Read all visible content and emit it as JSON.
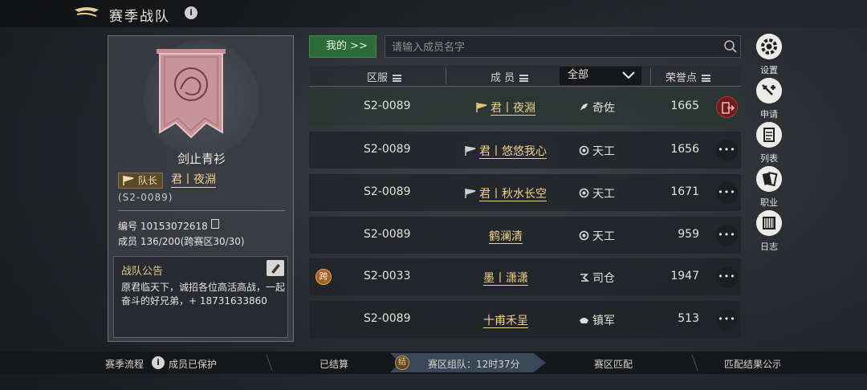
{
  "header": {
    "title": "赛季战队",
    "info": "i"
  },
  "team": {
    "name": "剑止青衫",
    "leader_badge": "队长",
    "leader_name": "君丨夜淵",
    "leader_server": "(S2-0089)",
    "id_label": "编号 10153072618",
    "members_label": "成员 136/200(跨赛区30/30)",
    "notice_title": "战队公告",
    "notice_text": "原君临天下，诚招各位高活高战，一起奋斗的好兄弟，+ 18731633860"
  },
  "toolbar": {
    "mine_label": "我的 >>",
    "search_placeholder": "请输入成员名字"
  },
  "table": {
    "headers": {
      "server": "区服",
      "member": "成 员",
      "filter": "全部",
      "honor": "荣誉点"
    },
    "rows": [
      {
        "server": "S2-0089",
        "name": "君丨夜淵",
        "job": "奇佐",
        "honor": "1665",
        "flag": "leader",
        "action": "leave",
        "cross": ""
      },
      {
        "server": "S2-0089",
        "name": "君丨悠悠我心",
        "job": "天工",
        "honor": "1656",
        "flag": "officer",
        "action": "more",
        "cross": ""
      },
      {
        "server": "S2-0089",
        "name": "君丨秋水长空",
        "job": "天工",
        "honor": "1671",
        "flag": "officer",
        "action": "more",
        "cross": ""
      },
      {
        "server": "S2-0089",
        "name": "鹤澜清",
        "job": "天工",
        "honor": "959",
        "flag": "",
        "action": "more",
        "cross": ""
      },
      {
        "server": "S2-0033",
        "name": "墨丨潇潇",
        "job": "司仓",
        "honor": "1947",
        "flag": "",
        "action": "more",
        "cross": "跨"
      },
      {
        "server": "S2-0089",
        "name": "十甫禾呈",
        "job": "镇军",
        "honor": "513",
        "flag": "",
        "action": "more",
        "cross": ""
      }
    ]
  },
  "side": [
    {
      "label": "设置",
      "icon": "gear-icon"
    },
    {
      "label": "申请",
      "icon": "apply-icon"
    },
    {
      "label": "列表",
      "icon": "list-icon"
    },
    {
      "label": "职业",
      "icon": "profession-icon"
    },
    {
      "label": "日志",
      "icon": "log-icon"
    }
  ],
  "bottom": {
    "season_flow": "赛季流程",
    "protected": "成员已保护",
    "settled": "已结算",
    "active_badge": "结",
    "active_stage": "赛区组队：12时37分",
    "match": "赛区匹配",
    "result": "匹配结果公示"
  },
  "colors": {
    "accent_gold": "#f1d38b",
    "green": "#2e6b3a",
    "leave_red": "#6a1f1f"
  }
}
